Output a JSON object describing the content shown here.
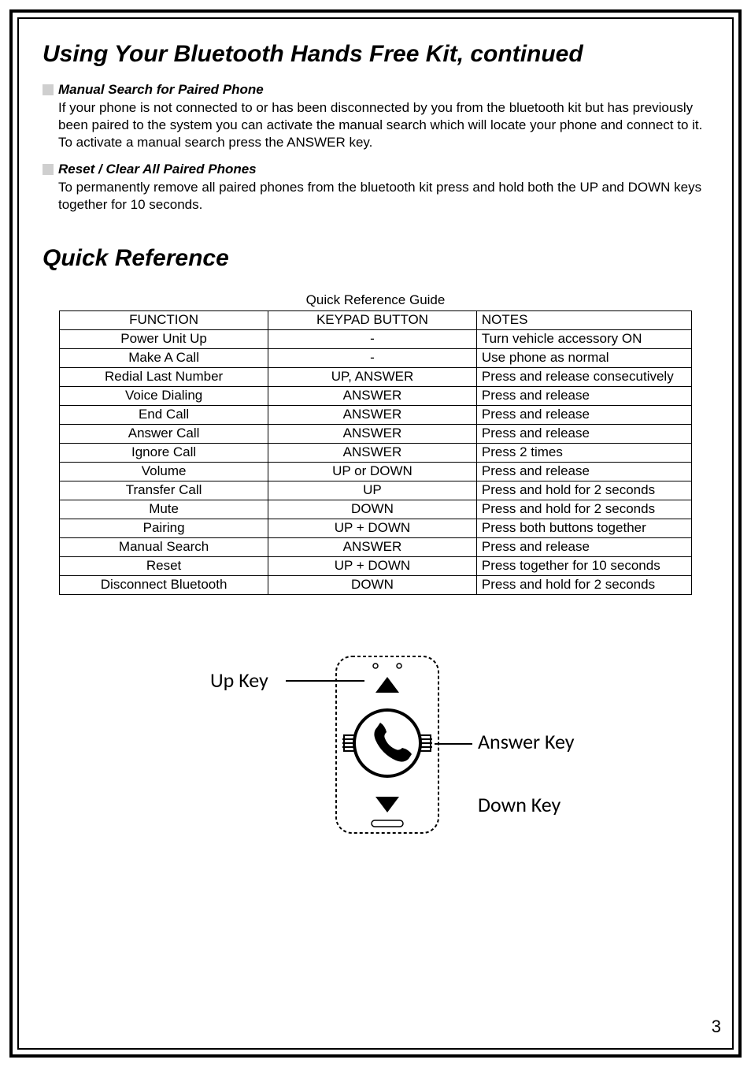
{
  "page_number": "3",
  "title_main": "Using Your Bluetooth Hands Free Kit, continued",
  "section1": {
    "heading": "Manual Search for Paired Phone",
    "body": "If your phone is not connected to or has been disconnected by you from the bluetooth kit but has previously been paired to the system you can activate the manual search which will locate your phone and connect to it. To activate a manual search press the ANSWER key."
  },
  "section2": {
    "heading": "Reset / Clear All Paired Phones",
    "body": "To permanently  remove all paired phones from the bluetooth kit press and hold both the UP and DOWN keys together for 10 seconds."
  },
  "title_qr": "Quick Reference",
  "table_caption": "Quick Reference Guide",
  "columns": {
    "fn": "FUNCTION",
    "kb": "KEYPAD BUTTON",
    "nt": "NOTES"
  },
  "rows": [
    {
      "fn": "Power Unit Up",
      "kb": "-",
      "nt": "Turn vehicle accessory ON"
    },
    {
      "fn": "Make A Call",
      "kb": "-",
      "nt": "Use phone as normal"
    },
    {
      "fn": "Redial Last Number",
      "kb": "UP, ANSWER",
      "nt": "Press and release consecutively"
    },
    {
      "fn": "Voice Dialing",
      "kb": "ANSWER",
      "nt": "Press and release"
    },
    {
      "fn": "End Call",
      "kb": "ANSWER",
      "nt": "Press and release"
    },
    {
      "fn": "Answer Call",
      "kb": "ANSWER",
      "nt": "Press and release"
    },
    {
      "fn": "Ignore Call",
      "kb": "ANSWER",
      "nt": "Press 2 times"
    },
    {
      "fn": "Volume",
      "kb": "UP or DOWN",
      "nt": "Press and release"
    },
    {
      "fn": "Transfer Call",
      "kb": "UP",
      "nt": "Press and hold for 2 seconds"
    },
    {
      "fn": "Mute",
      "kb": "DOWN",
      "nt": "Press and hold for 2 seconds"
    },
    {
      "fn": "Pairing",
      "kb": "UP + DOWN",
      "nt": "Press both buttons together"
    },
    {
      "fn": "Manual Search",
      "kb": "ANSWER",
      "nt": "Press and release"
    },
    {
      "fn": "Reset",
      "kb": "UP + DOWN",
      "nt": "Press together for 10 seconds"
    },
    {
      "fn": "Disconnect Bluetooth",
      "kb": "DOWN",
      "nt": "Press and hold for 2 seconds"
    }
  ],
  "diagram": {
    "up_label": "Up Key",
    "answer_label": "Answer Key",
    "down_label": "Down Key"
  }
}
